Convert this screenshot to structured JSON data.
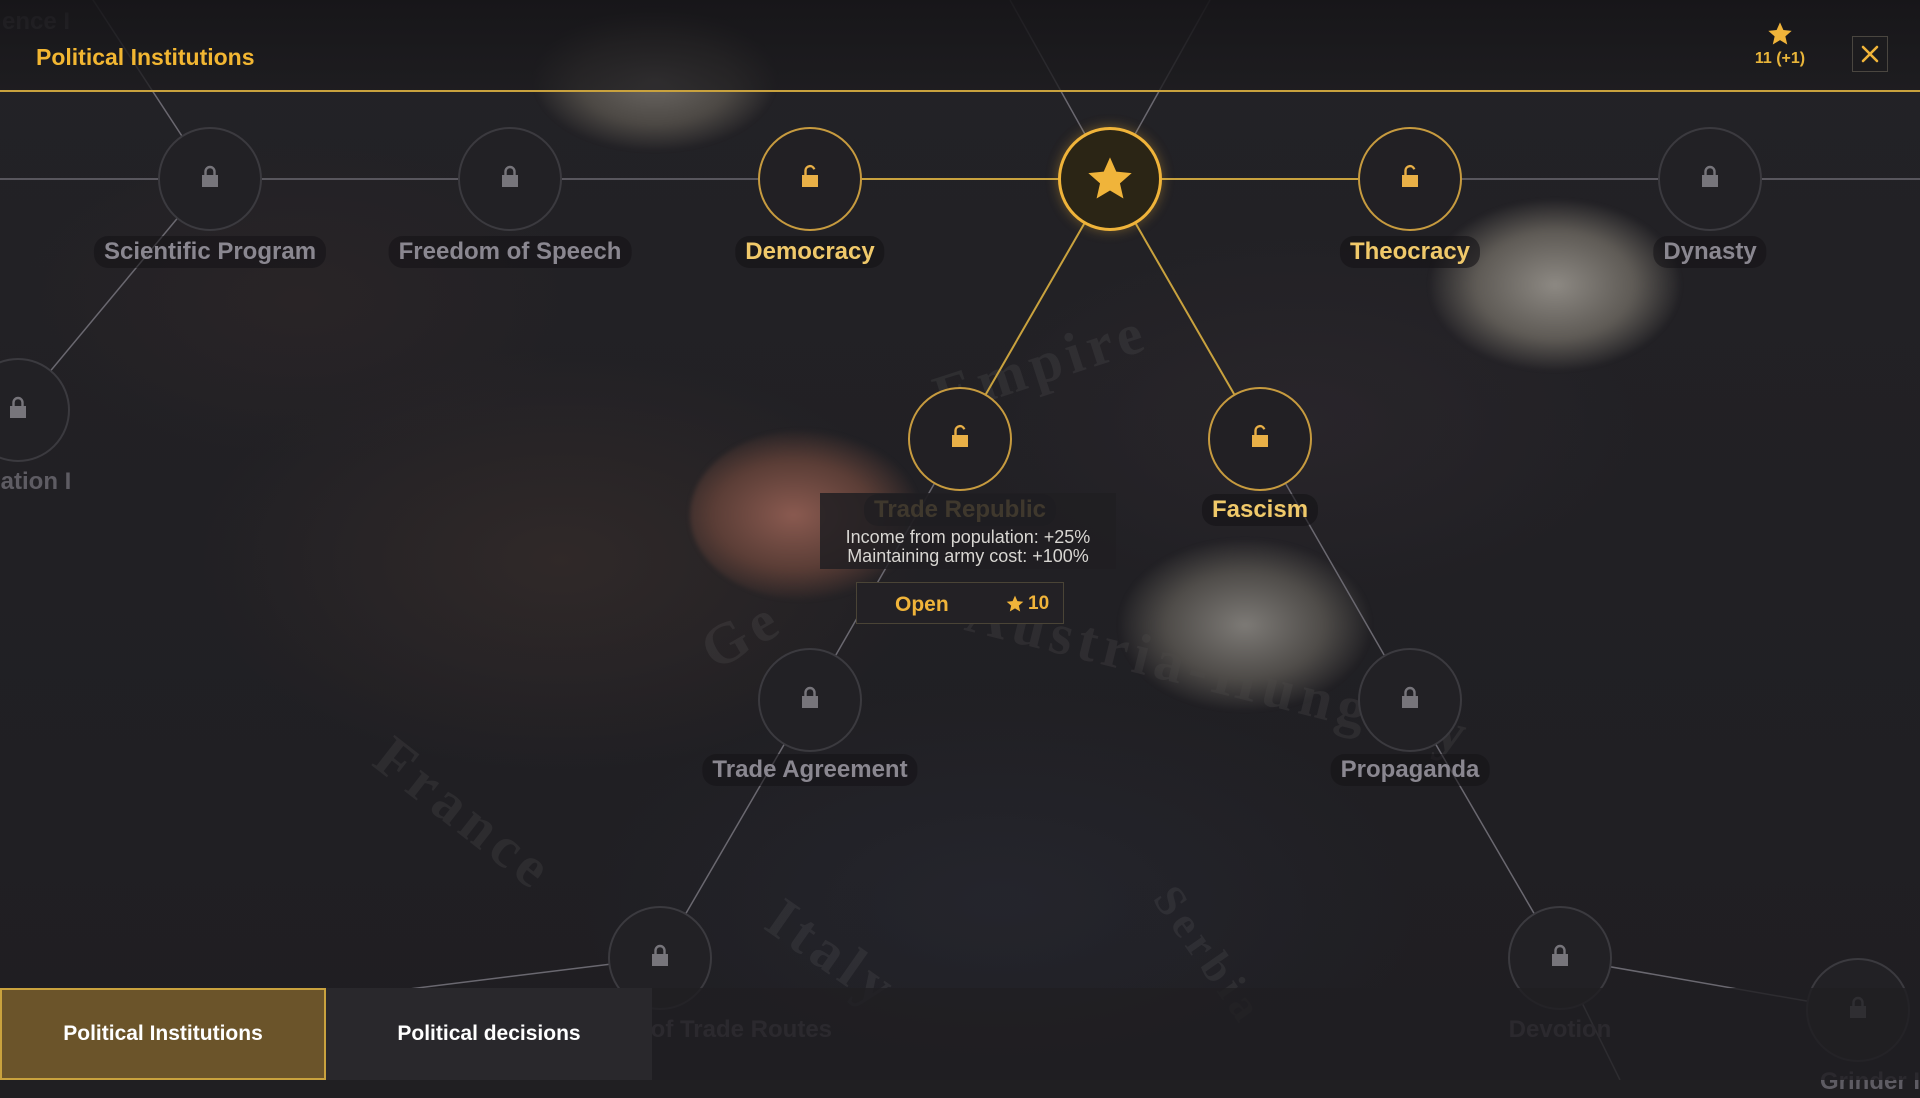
{
  "header": {
    "title": "Political Institutions",
    "points_text": "11 (+1)"
  },
  "colors": {
    "accent": "#f0b43a",
    "line_active": "#c9a23e",
    "line_inactive": "#6a6870",
    "node_border_locked": "#3b3a3f"
  },
  "map_labels": [
    "Empire",
    "Austria-Hungary",
    "France",
    "Italy",
    "Serbia",
    "Ge"
  ],
  "tree": {
    "root_icon": "star-icon",
    "nodes": [
      {
        "id": "edge-top-left",
        "label": "ence I",
        "state": "offscreen"
      },
      {
        "id": "scientific-program",
        "label": "Scientific Program",
        "state": "locked"
      },
      {
        "id": "freedom-of-speech",
        "label": "Freedom of Speech",
        "state": "locked"
      },
      {
        "id": "democracy",
        "label": "Democracy",
        "state": "available"
      },
      {
        "id": "theocracy",
        "label": "Theocracy",
        "state": "available"
      },
      {
        "id": "dynasty",
        "label": "Dynasty",
        "state": "locked"
      },
      {
        "id": "edge-left",
        "label": "ation I",
        "state": "locked"
      },
      {
        "id": "trade-republic",
        "label": "Trade Republic",
        "state": "available"
      },
      {
        "id": "fascism",
        "label": "Fascism",
        "state": "available"
      },
      {
        "id": "trade-agreement",
        "label": "Trade Agreement",
        "state": "locked"
      },
      {
        "id": "propaganda",
        "label": "Propaganda",
        "state": "locked"
      },
      {
        "id": "trade-routes",
        "label": "ent of Trade Routes",
        "state": "locked"
      },
      {
        "id": "devotion",
        "label": "Devotion",
        "state": "locked"
      },
      {
        "id": "edge-bottom-right",
        "label": "Grinder I",
        "state": "locked"
      }
    ]
  },
  "tooltip": {
    "line1": "Income from population: +25%",
    "line2": "Maintaining army cost: +100%",
    "button_label": "Open",
    "cost": "10"
  },
  "tabs": [
    {
      "label": "Political Institutions",
      "active": true
    },
    {
      "label": "Political decisions",
      "active": false
    }
  ]
}
